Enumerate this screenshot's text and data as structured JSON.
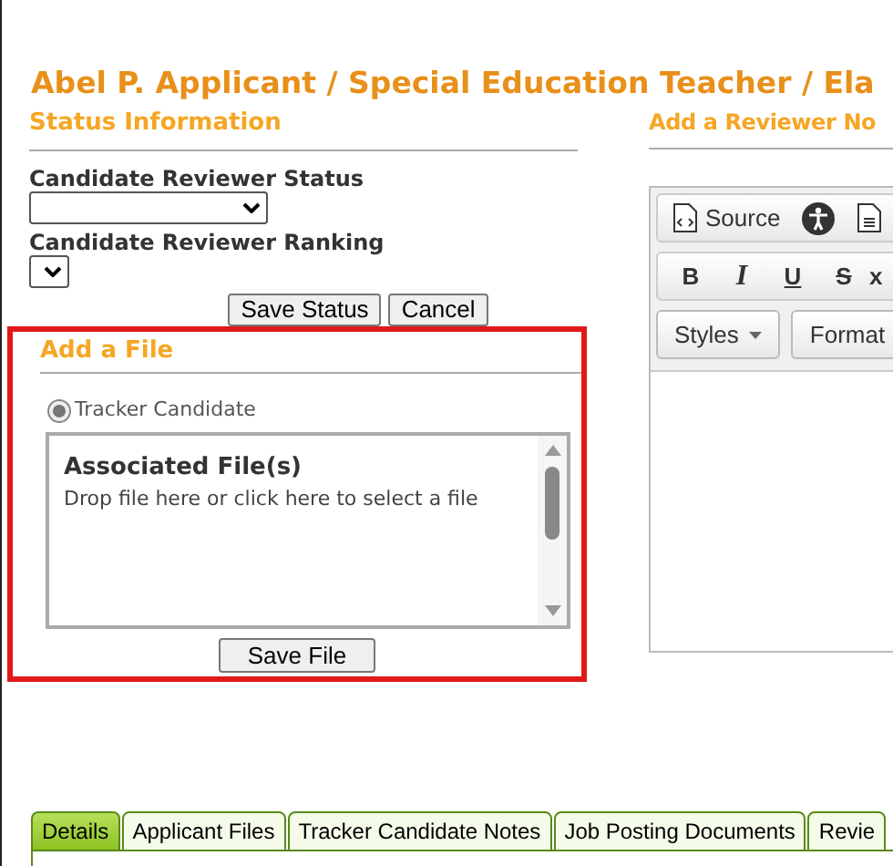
{
  "title": "Abel P. Applicant / Special Education Teacher / Ela",
  "status": {
    "heading": "Status Information",
    "fields": [
      {
        "label": "Candidate Reviewer Status",
        "kind": "wide"
      },
      {
        "label": "Candidate Reviewer Ranking",
        "kind": "narrow"
      }
    ],
    "buttons": [
      "Save Status",
      "Cancel"
    ]
  },
  "add_file": {
    "heading": "Add a File",
    "radio": {
      "label": "Tracker Candidate",
      "selected": true
    },
    "drop_title": "Associated File(s)",
    "drop_hint": "Drop file here or click here to select a file",
    "button": "Save File"
  },
  "reviewer_note": {
    "heading": "Add a Reviewer No",
    "toolbar_rows": [
      [
        {
          "kind": "source",
          "label": "Source"
        },
        {
          "kind": "accessibility"
        },
        {
          "kind": "document"
        }
      ],
      [
        {
          "kind": "bold",
          "label": "B"
        },
        {
          "kind": "italic",
          "label": "I"
        },
        {
          "kind": "underline",
          "label": "U"
        },
        {
          "kind": "strike",
          "label": "S"
        },
        {
          "kind": "subscript",
          "label": "x"
        }
      ],
      [
        {
          "kind": "dropdown",
          "label": "Styles"
        },
        {
          "kind": "dropdown",
          "label": "Format"
        }
      ]
    ]
  },
  "tabs": [
    {
      "label": "Details",
      "selected": true
    },
    {
      "label": "Applicant Files",
      "selected": false
    },
    {
      "label": "Tracker Candidate Notes",
      "selected": false
    },
    {
      "label": "Job Posting Documents",
      "selected": false
    },
    {
      "label": "Revie",
      "selected": false
    }
  ]
}
